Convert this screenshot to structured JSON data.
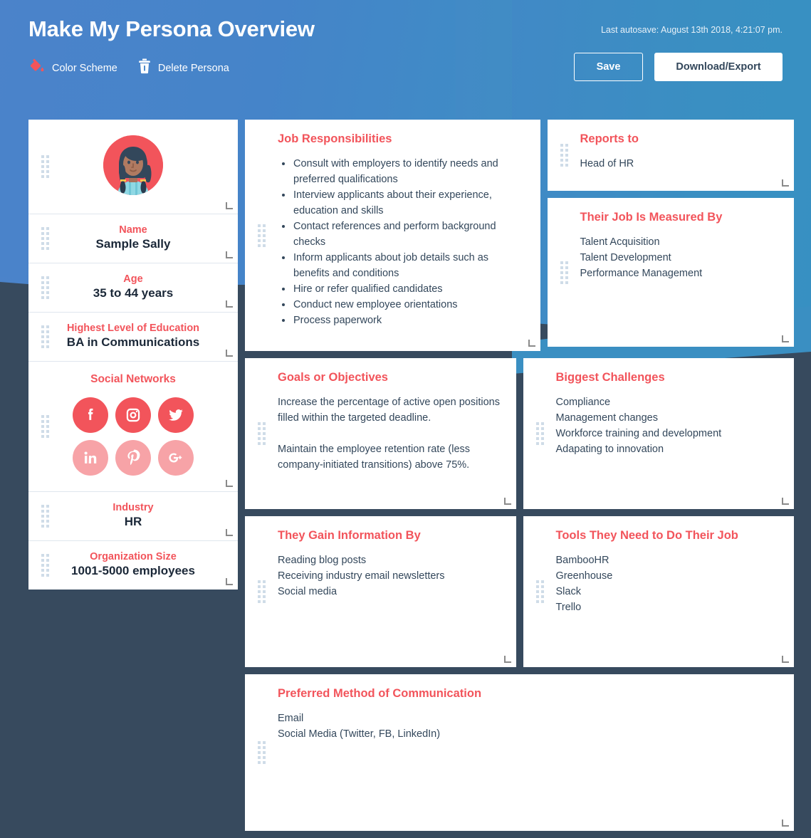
{
  "header": {
    "title": "Make My Persona Overview",
    "autosave": "Last autosave: August 13th 2018, 4:21:07 pm.",
    "actions": [
      {
        "label": "Color Scheme",
        "icon": "paint-bucket-icon"
      },
      {
        "label": "Delete Persona",
        "icon": "trash-icon"
      }
    ],
    "save_label": "Save",
    "download_label": "Download/Export"
  },
  "colors": {
    "accent_red": "#f2545b",
    "accent_red_light": "#f7a3a7",
    "blue_top_left": "#4b83ca",
    "blue_right": "#3a8fc2",
    "navy": "#374a5e",
    "text_dark": "#33475b",
    "card_white": "#ffffff"
  },
  "persona": {
    "avatar_name": "persona-avatar",
    "sections": [
      {
        "label": "Name",
        "value": "Sample Sally"
      },
      {
        "label": "Age",
        "value": "35 to 44 years"
      },
      {
        "label": "Highest Level of Education",
        "value": "BA in Communications"
      },
      {
        "label": "Industry",
        "value": "HR"
      },
      {
        "label": "Organization Size",
        "value": "1001-5000 employees"
      }
    ],
    "social": {
      "title": "Social Networks",
      "icons": [
        {
          "name": "facebook-icon",
          "active": true
        },
        {
          "name": "instagram-icon",
          "active": true
        },
        {
          "name": "twitter-icon",
          "active": true
        },
        {
          "name": "linkedin-icon",
          "active": false
        },
        {
          "name": "pinterest-icon",
          "active": false
        },
        {
          "name": "googleplus-icon",
          "active": false
        }
      ]
    }
  },
  "cards": {
    "job_responsibilities": {
      "title": "Job Responsibilities",
      "items": [
        "Consult with employers to identify needs and preferred qualifications",
        "Interview applicants about their experience, education and skills",
        "Contact references and perform background checks",
        "Inform applicants about job details such as benefits and conditions",
        "Hire or refer qualified candidates",
        "Conduct new employee orientations",
        "Process paperwork"
      ]
    },
    "reports_to": {
      "title": "Reports to",
      "items": [
        "Head of HR"
      ]
    },
    "measured_by": {
      "title": "Their Job Is Measured By",
      "items": [
        "Talent Acquisition",
        "Talent Development",
        "Performance Management"
      ]
    },
    "goals": {
      "title": "Goals or Objectives",
      "paragraphs": [
        "Increase the percentage of active open positions filled within the targeted deadline.",
        "Maintain the employee retention rate (less company-initiated transitions) above 75%."
      ]
    },
    "challenges": {
      "title": "Biggest Challenges",
      "items": [
        "Compliance",
        "Management changes",
        "Workforce training and development",
        "Adapating to innovation"
      ]
    },
    "information": {
      "title": "They Gain Information By",
      "items": [
        "Reading blog posts",
        "Receiving industry email newsletters",
        "Social media"
      ]
    },
    "tools": {
      "title": "Tools They Need to Do Their Job",
      "items": [
        "BambooHR",
        "Greenhouse",
        "Slack",
        "Trello"
      ]
    },
    "communication": {
      "title": "Preferred Method of Communication",
      "items": [
        "Email",
        "Social Media (Twitter, FB, LinkedIn)"
      ]
    }
  }
}
